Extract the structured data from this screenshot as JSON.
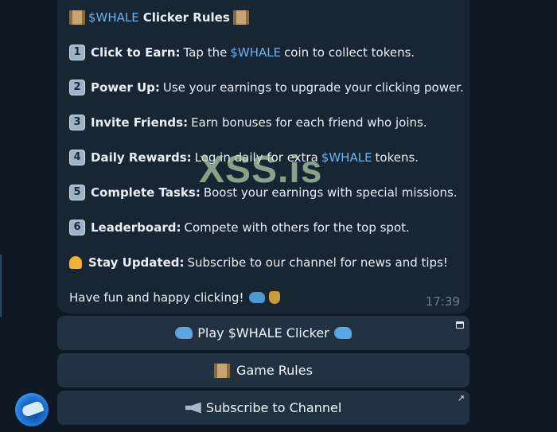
{
  "message": {
    "title_prefix": "$WHALE",
    "title_rest": "Clicker Rules",
    "rules": [
      {
        "num": "1",
        "bold": "Click to Earn:",
        "pre": "Tap the",
        "link": "$WHALE",
        "post": "coin to collect tokens."
      },
      {
        "num": "2",
        "bold": "Power Up:",
        "text": "Use your earnings to upgrade your clicking power."
      },
      {
        "num": "3",
        "bold": "Invite Friends:",
        "text": "Earn bonuses for each friend who joins."
      },
      {
        "num": "4",
        "bold": "Daily Rewards:",
        "pre": "Log in daily for extra",
        "link": "$WHALE",
        "post": "tokens."
      },
      {
        "num": "5",
        "bold": "Complete Tasks:",
        "text": "Boost your earnings with special missions."
      },
      {
        "num": "6",
        "bold": "Leaderboard:",
        "text": "Compete with others for the top spot."
      }
    ],
    "stay_updated": {
      "bold": "Stay Updated:",
      "text": "Subscribe to our channel for news and tips!"
    },
    "closing": "Have fun and happy clicking!",
    "time": "17:39"
  },
  "buttons": {
    "play": "Play $WHALE Clicker",
    "rules": "Game Rules",
    "subscribe": "Subscribe to Channel"
  },
  "watermark": "XSS.is",
  "icons": {
    "title": "scroll-icon",
    "stay_updated": "bell-icon",
    "play": "whale-icon",
    "rules": "scroll-icon",
    "subscribe": "megaphone-icon",
    "play_corner": "web-app-icon",
    "subscribe_corner": "external-link-arrow-icon"
  },
  "colors": {
    "link": "#68b4f2",
    "bubble": "#182533",
    "button": "#223241",
    "background": "#0f1923"
  }
}
